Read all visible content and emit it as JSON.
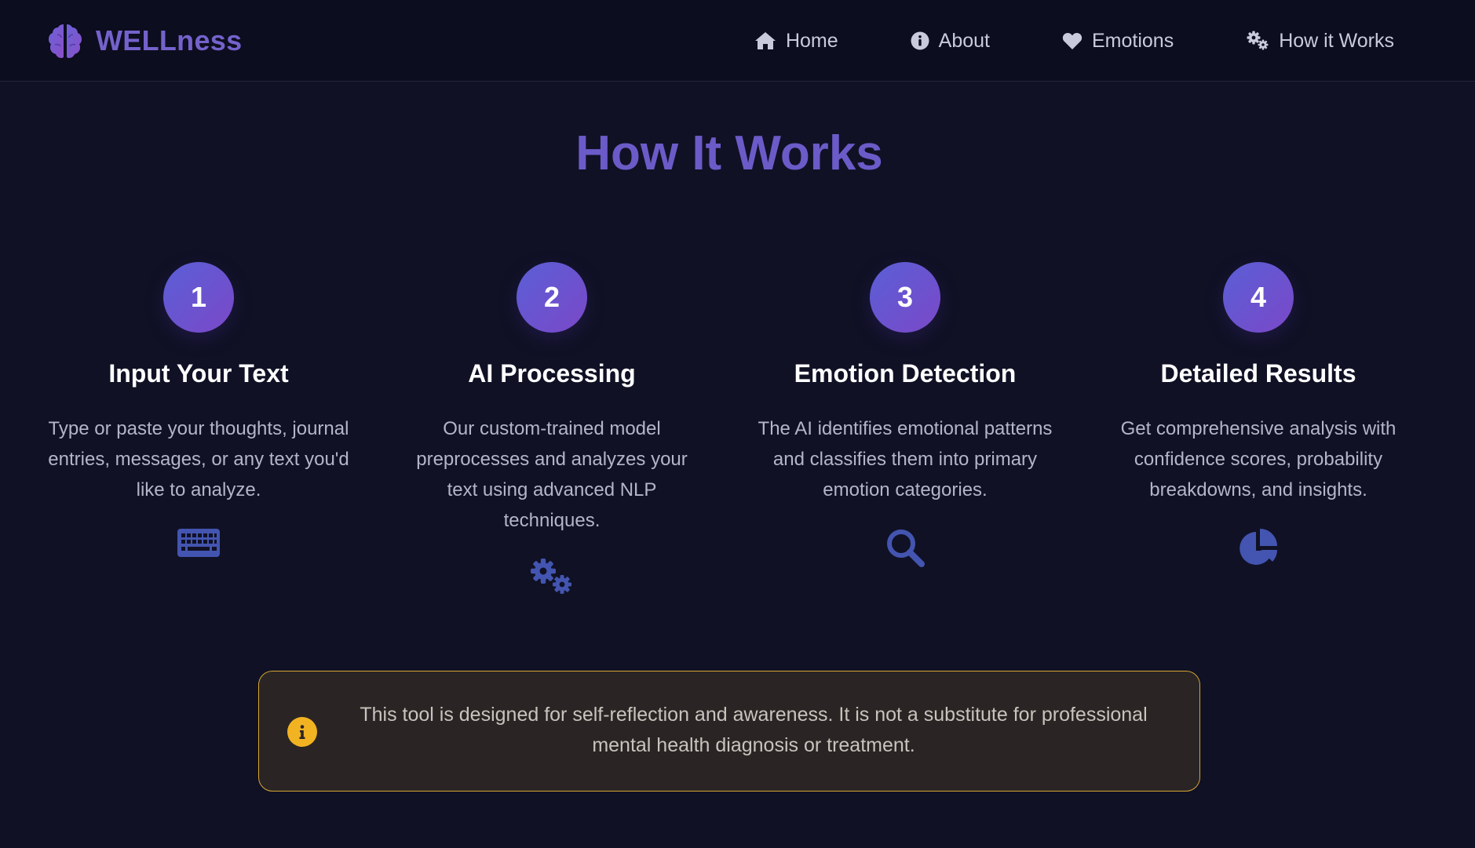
{
  "brand": {
    "name": "WELLness",
    "icon": "brain-icon",
    "color": "#7462cc"
  },
  "nav": {
    "items": [
      {
        "label": "Home",
        "icon": "home-icon"
      },
      {
        "label": "About",
        "icon": "info-circle-icon"
      },
      {
        "label": "Emotions",
        "icon": "heart-icon"
      },
      {
        "label": "How it Works",
        "icon": "cogs-icon"
      }
    ]
  },
  "section": {
    "title": "How It Works"
  },
  "steps": [
    {
      "number": "1",
      "title": "Input Your Text",
      "description": "Type or paste your thoughts, journal entries, messages, or any text you'd like to analyze.",
      "icon": "keyboard-icon"
    },
    {
      "number": "2",
      "title": "AI Processing",
      "description": "Our custom-trained model preprocesses and analyzes your text using advanced NLP techniques.",
      "icon": "cogs-icon"
    },
    {
      "number": "3",
      "title": "Emotion Detection",
      "description": "The AI identifies emotional patterns and classifies them into primary emotion categories.",
      "icon": "search-icon"
    },
    {
      "number": "4",
      "title": "Detailed Results",
      "description": "Get comprehensive analysis with confidence scores, probability breakdowns, and insights.",
      "icon": "pie-chart-icon"
    }
  ],
  "disclaimer": {
    "icon": "info-icon",
    "text": "This tool is designed for self-reflection and awareness. It is not a substitute for professional mental health diagnosis or treatment."
  },
  "colors": {
    "background": "#101125",
    "accent": "#6b5bc8",
    "step_icon": "#4355b0",
    "warning_border": "#d6a632",
    "warning_icon": "#f2b322"
  }
}
